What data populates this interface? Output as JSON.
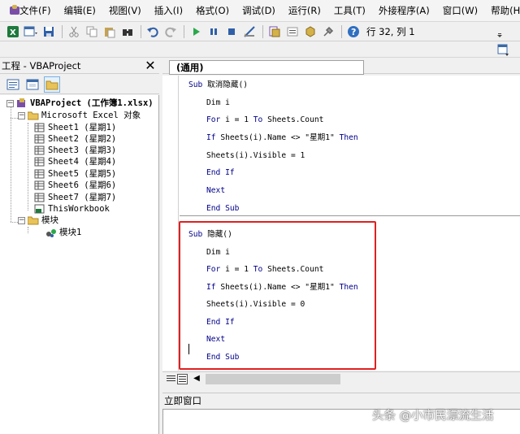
{
  "menubar": {
    "items": [
      "文件(F)",
      "编辑(E)",
      "视图(V)",
      "插入(I)",
      "格式(O)",
      "调试(D)",
      "运行(R)",
      "工具(T)",
      "外接程序(A)",
      "窗口(W)",
      "帮助(H)"
    ]
  },
  "toolbar": {
    "position": "行 32, 列 1",
    "icons": [
      "excel-icon",
      "insert-module-icon",
      "save-icon",
      "cut-icon",
      "copy-icon",
      "paste-icon",
      "find-icon",
      "undo-icon",
      "redo-icon",
      "run-icon",
      "break-icon",
      "reset-icon",
      "design-mode-icon",
      "project-explorer-icon",
      "properties-icon",
      "object-browser-icon",
      "toolbox-icon",
      "help-icon"
    ]
  },
  "project": {
    "title": "工程 - VBAProject",
    "close": "✕",
    "tree": {
      "root": "VBAProject (工作簿1.xlsx)",
      "excel_objects": "Microsoft Excel 对象",
      "sheets": [
        "Sheet1 (星期1)",
        "Sheet2 (星期2)",
        "Sheet3 (星期3)",
        "Sheet4 (星期4)",
        "Sheet5 (星期5)",
        "Sheet6 (星期6)",
        "Sheet7 (星期7)",
        "ThisWorkbook"
      ],
      "modules_folder": "模块",
      "modules": [
        "模块1"
      ]
    }
  },
  "code": {
    "object_combo": "(通用)",
    "proc1": {
      "sub": "Sub ",
      "name": "取消隐藏()",
      "dim": "Dim i",
      "for_kw": "For",
      "for_mid": " i = 1 ",
      "to_kw": "To",
      "for_end": " Sheets.Count",
      "if_kw": "If",
      "if_mid": " Sheets(i).Name <> \"星期1\" ",
      "then_kw": "Then",
      "assign": "Sheets(i).Visible = 1",
      "endif": "End If",
      "next": "Next",
      "endsub": "End Sub"
    },
    "proc2": {
      "sub": "Sub ",
      "name": "隐藏()",
      "dim": "Dim i",
      "for_kw": "For",
      "for_mid": " i = 1 ",
      "to_kw": "To",
      "for_end": " Sheets.Count",
      "if_kw": "If",
      "if_mid": " Sheets(i).Name <> \"星期1\" ",
      "then_kw": "Then",
      "assign": "Sheets(i).Visible = 0",
      "endif": "End If",
      "next": "Next",
      "endsub": "End Sub"
    }
  },
  "immediate": {
    "title": "立即窗口"
  },
  "watermark": "头条 @小市民漂流生活",
  "colors": {
    "keyword": "#00008b",
    "highlight": "#e02020",
    "accent": "#7ab2e4"
  }
}
